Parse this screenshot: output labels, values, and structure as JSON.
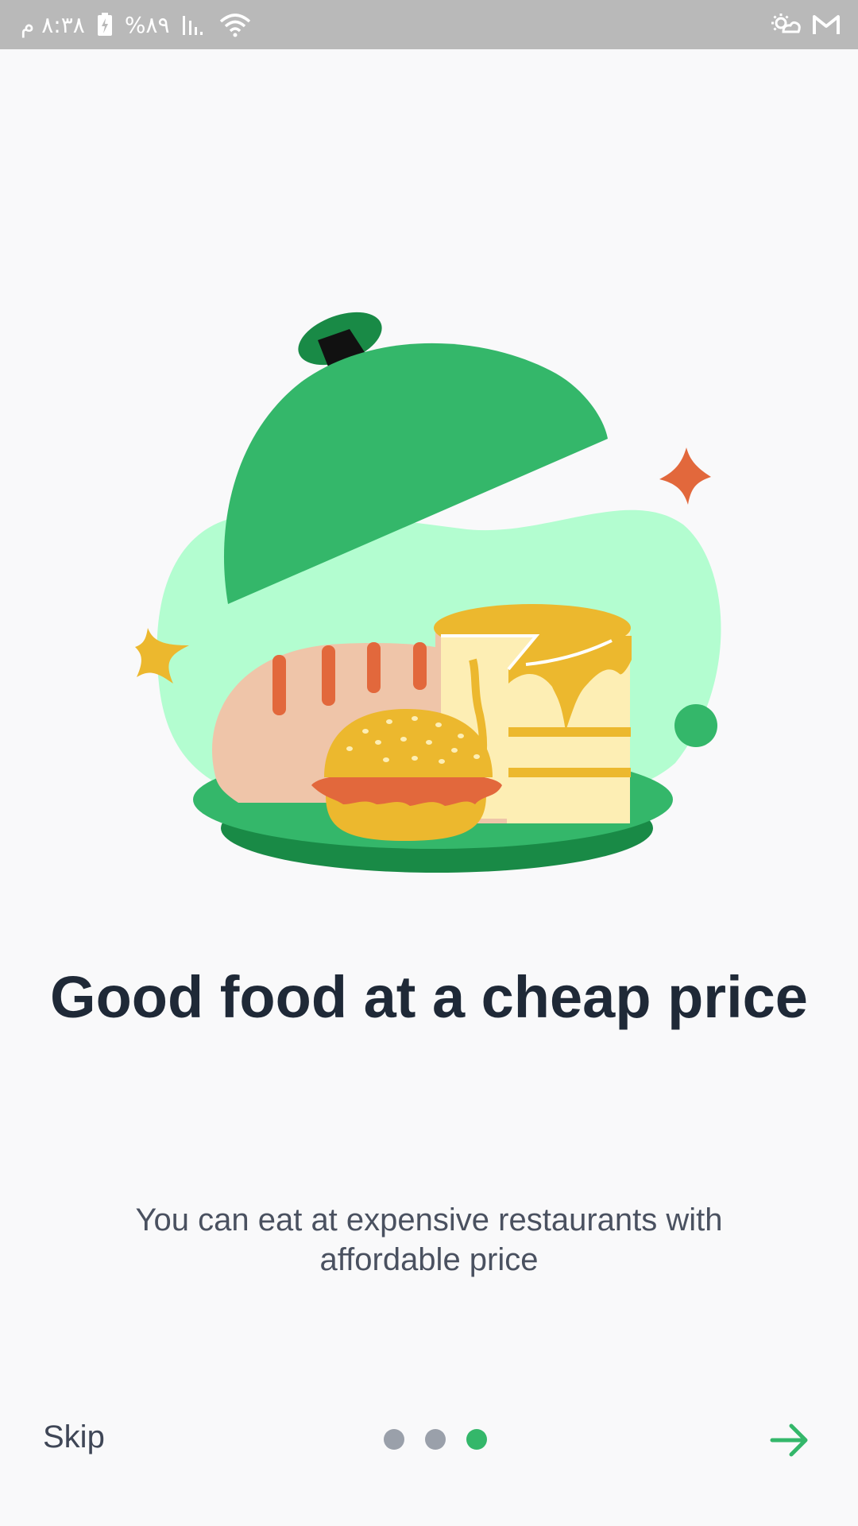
{
  "status_bar": {
    "time": "٨:٣٨ م",
    "battery": "%٨٩",
    "icons": [
      "battery-charging-icon",
      "signal-icon",
      "wifi-icon",
      "weather-icon",
      "gmail-icon"
    ]
  },
  "onboarding": {
    "title": "Good food at a cheap price",
    "subtitle": "You can eat at expensive restaurants with affordable price",
    "skip_label": "Skip",
    "page_count": 3,
    "current_page": 3,
    "next_icon": "arrow-right-icon"
  },
  "colors": {
    "accent": "#34b76a",
    "title": "#1f2937",
    "text": "#4a5160",
    "blob": "#b3fdd0",
    "cheese": "#ecb82e",
    "orange": "#e2683c"
  }
}
